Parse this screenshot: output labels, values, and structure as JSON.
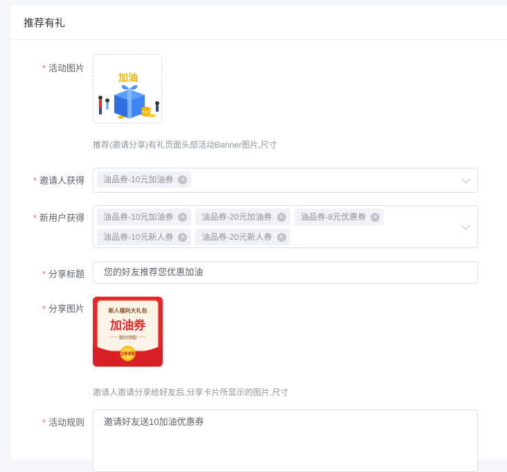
{
  "header": {
    "title": "推荐有礼"
  },
  "form": {
    "activity_image": {
      "label": "活动图片",
      "image_text": "加油",
      "hint": "推荐(邀请分享)有礼页面头部活动Banner图片,尺寸"
    },
    "inviter_reward": {
      "label": "邀请人获得",
      "tags": [
        "油品券-10元加油券"
      ]
    },
    "new_user_reward": {
      "label": "新用户获得",
      "tags": [
        "油品券-10元加油券",
        "油品券-20元加油券",
        "油品券-8元优惠券",
        "油品券-10元新人券",
        "油品券-20元新人券"
      ]
    },
    "share_title": {
      "label": "分享标题",
      "value": "您的好友推荐您优惠加油"
    },
    "share_image": {
      "label": "分享图片",
      "banner_text": "新人福利大礼包",
      "main_text": "加油券",
      "sub_text": "限时领取",
      "button_text": "立即领取",
      "hint": "邀请人邀请分享给好友后,分享卡片所显示的图片,尺寸"
    },
    "rules": {
      "label": "活动规则",
      "value": "邀请好友送10加油优惠券"
    }
  },
  "colors": {
    "required": "#f56c6c",
    "brand_red": "#e8262b",
    "coupon_gold": "#f5b400"
  }
}
